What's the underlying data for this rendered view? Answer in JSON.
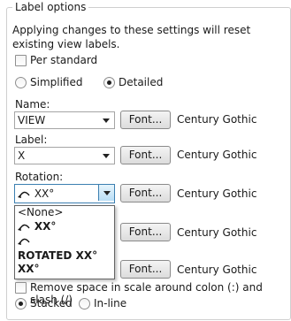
{
  "group": {
    "title": "Label options",
    "note": "Applying changes to these settings will reset existing view labels."
  },
  "per_standard": {
    "label": "Per standard",
    "checked": false
  },
  "style_radios": [
    {
      "label": "Simplified",
      "selected": false
    },
    {
      "label": "Detailed",
      "selected": true
    }
  ],
  "name": {
    "label": "Name:",
    "value": "VIEW",
    "font_button": "Font...",
    "font": "Century Gothic"
  },
  "label_field": {
    "label": "Label:",
    "value": "X",
    "font_button": "Font...",
    "font": "Century Gothic"
  },
  "rotation": {
    "label": "Rotation:",
    "value": "XX°",
    "font_button": "Font...",
    "font": "Century Gothic",
    "options": [
      "<None>",
      "XX°",
      "",
      "ROTATED XX°",
      "XX°"
    ]
  },
  "hidden_row_4": {
    "font_button": "Font...",
    "font": "Century Gothic"
  },
  "hidden_row_5": {
    "font_button": "Font...",
    "font": "Century Gothic"
  },
  "remove_space": {
    "label": "Remove space in scale around colon (:) and slash (/)",
    "checked": false
  },
  "layout_radios": [
    {
      "label": "Stacked",
      "selected": true
    },
    {
      "label": "In-line",
      "selected": false
    }
  ]
}
